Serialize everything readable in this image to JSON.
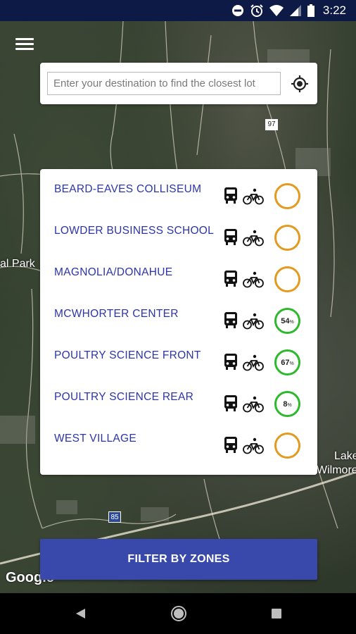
{
  "status_bar": {
    "time": "3:22",
    "icons": [
      "do-not-disturb-icon",
      "alarm-icon",
      "wifi-icon",
      "signal-icon",
      "battery-icon"
    ]
  },
  "map": {
    "labels": {
      "park": "al Park",
      "lake": "Lake",
      "lake2": "Wilmore",
      "interstate": "85",
      "shield97": "97"
    },
    "attribution": "Google"
  },
  "search": {
    "placeholder": "Enter your destination to find the closest lot",
    "value": ""
  },
  "lots": [
    {
      "name": "BEARD-EAVES COLLISEUM",
      "availability": "",
      "status": "orange"
    },
    {
      "name": "LOWDER BUSINESS SCHOOL",
      "availability": "",
      "status": "orange"
    },
    {
      "name": "MAGNOLIA/DONAHUE",
      "availability": "",
      "status": "orange"
    },
    {
      "name": "MCWHORTER CENTER",
      "availability": "54",
      "status": "green"
    },
    {
      "name": "POULTRY SCIENCE FRONT",
      "availability": "67",
      "status": "green"
    },
    {
      "name": "POULTRY SCIENCE REAR",
      "availability": "8",
      "status": "green"
    },
    {
      "name": "WEST VILLAGE",
      "availability": "",
      "status": "orange"
    }
  ],
  "percent_sign": "%",
  "filter_button": {
    "label": "FILTER BY ZONES"
  },
  "colors": {
    "accent": "#3949ab",
    "lot_text": "#2b35a8",
    "ring_orange": "#e39a1e",
    "ring_green": "#2db82d",
    "status_bar": "#0c1a45"
  }
}
